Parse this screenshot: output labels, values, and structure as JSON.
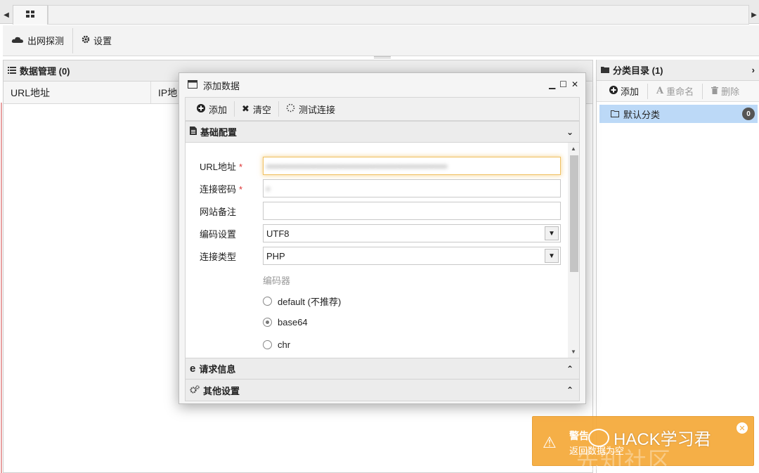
{
  "toolbar": {
    "detect_label": "出网探测",
    "settings_label": "设置"
  },
  "data_panel": {
    "title": "数据管理 (0)",
    "columns": [
      "URL地址",
      "IP地"
    ]
  },
  "category_panel": {
    "title": "分类目录 (1)",
    "add_label": "添加",
    "rename_label": "重命名",
    "delete_label": "删除",
    "items": [
      {
        "label": "默认分类",
        "count": "0"
      }
    ]
  },
  "dialog": {
    "title": "添加数据",
    "toolbar": {
      "add_label": "添加",
      "clear_label": "清空",
      "test_label": "测试连接"
    },
    "section_basic": "基础配置",
    "section_request": "请求信息",
    "section_other": "其他设置",
    "fields": {
      "url_label": "URL地址",
      "url_value": "▪▪▪▪▪▪▪▪▪▪▪▪▪▪▪▪▪▪▪▪▪▪▪▪▪▪▪▪▪▪▪▪▪▪▪▪▪▪▪▪▪▪▪▪▪▪",
      "password_label": "连接密码",
      "password_value": "▪",
      "note_label": "网站备注",
      "note_value": "",
      "encoding_label": "编码设置",
      "encoding_value": "UTF8",
      "type_label": "连接类型",
      "type_value": "PHP",
      "required_mark": "*"
    },
    "encoder_label": "编码器",
    "encoders": [
      {
        "label": "default (不推荐)",
        "selected": false
      },
      {
        "label": "base64",
        "selected": true
      },
      {
        "label": "chr",
        "selected": false
      }
    ]
  },
  "toast": {
    "title": "警告",
    "message": "返回数据为空",
    "watermark": "HACK学习君",
    "watermark2": "先知社区"
  }
}
